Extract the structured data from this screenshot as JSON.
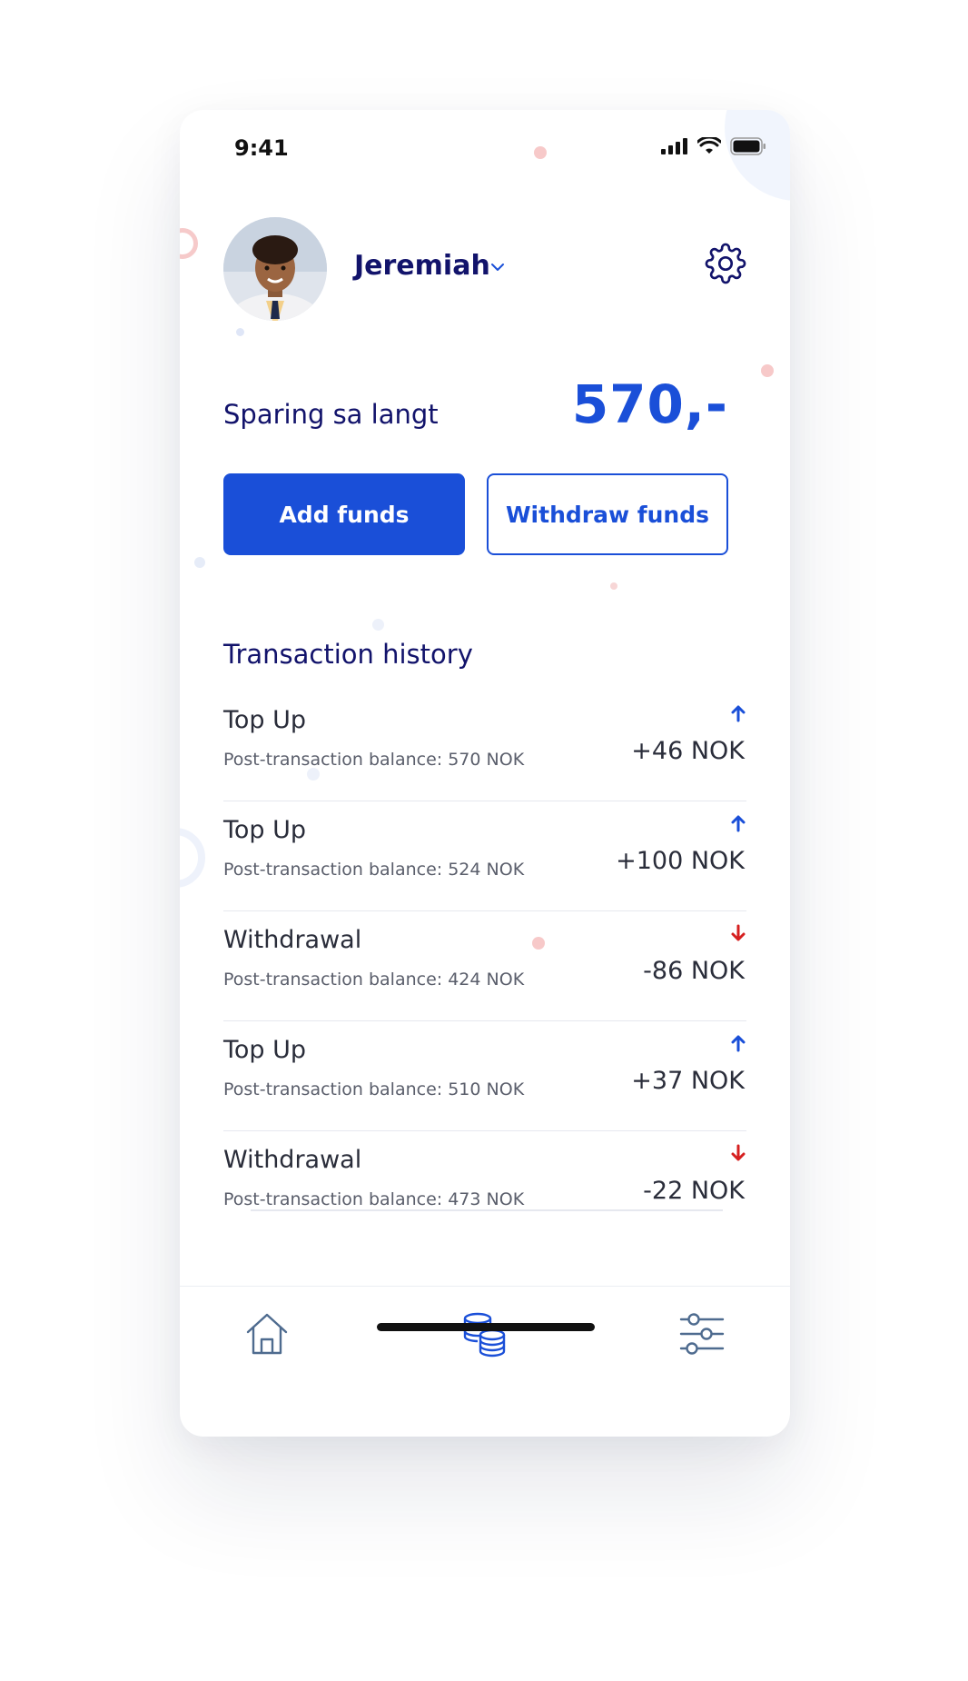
{
  "status_bar": {
    "time": "9:41"
  },
  "profile": {
    "name": "Jeremiah"
  },
  "savings": {
    "label": "Sparing sa langt",
    "amount": "570,-"
  },
  "actions": {
    "add_label": "Add funds",
    "withdraw_label": "Withdraw funds"
  },
  "history": {
    "title": "Transaction history",
    "items": [
      {
        "type": "Top Up",
        "balance": "Post-transaction balance: 570 NOK",
        "amount": "+46 NOK",
        "direction": "up"
      },
      {
        "type": "Top Up",
        "balance": "Post-transaction balance: 524 NOK",
        "amount": "+100 NOK",
        "direction": "up"
      },
      {
        "type": "Withdrawal",
        "balance": "Post-transaction balance: 424 NOK",
        "amount": "-86 NOK",
        "direction": "down"
      },
      {
        "type": "Top Up",
        "balance": "Post-transaction balance: 510 NOK",
        "amount": "+37 NOK",
        "direction": "up"
      },
      {
        "type": "Withdrawal",
        "balance": "Post-transaction balance: 473 NOK",
        "amount": "-22 NOK",
        "direction": "down"
      }
    ]
  },
  "nav": {
    "items": [
      "home-icon",
      "coins-icon",
      "sliders-icon"
    ],
    "active": "coins-icon"
  },
  "colors": {
    "primary": "#1a4fd8",
    "navy": "#12136b",
    "up": "#1a4fd8",
    "down": "#d62020"
  }
}
